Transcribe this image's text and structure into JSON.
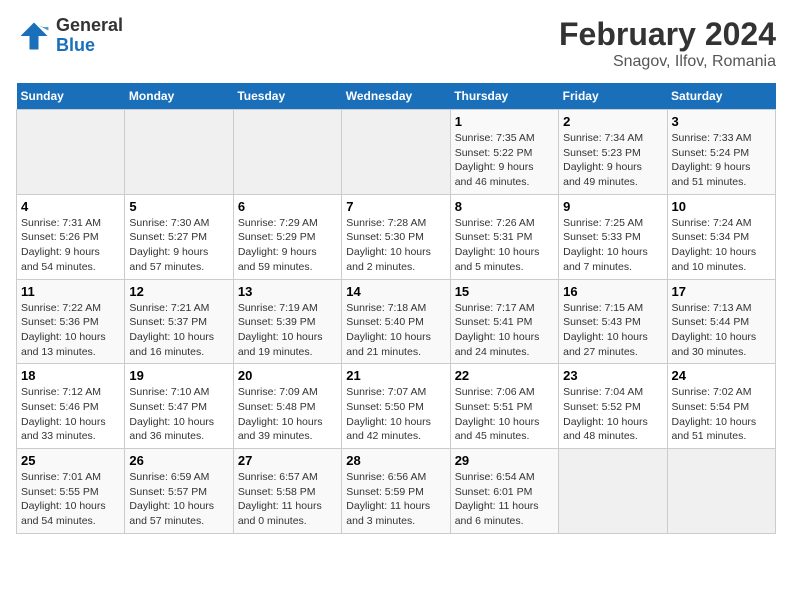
{
  "header": {
    "logo_general": "General",
    "logo_blue": "Blue",
    "title": "February 2024",
    "subtitle": "Snagov, Ilfov, Romania"
  },
  "calendar": {
    "days_of_week": [
      "Sunday",
      "Monday",
      "Tuesday",
      "Wednesday",
      "Thursday",
      "Friday",
      "Saturday"
    ],
    "weeks": [
      [
        {
          "day": "",
          "info": ""
        },
        {
          "day": "",
          "info": ""
        },
        {
          "day": "",
          "info": ""
        },
        {
          "day": "",
          "info": ""
        },
        {
          "day": "1",
          "info": "Sunrise: 7:35 AM\nSunset: 5:22 PM\nDaylight: 9 hours\nand 46 minutes."
        },
        {
          "day": "2",
          "info": "Sunrise: 7:34 AM\nSunset: 5:23 PM\nDaylight: 9 hours\nand 49 minutes."
        },
        {
          "day": "3",
          "info": "Sunrise: 7:33 AM\nSunset: 5:24 PM\nDaylight: 9 hours\nand 51 minutes."
        }
      ],
      [
        {
          "day": "4",
          "info": "Sunrise: 7:31 AM\nSunset: 5:26 PM\nDaylight: 9 hours\nand 54 minutes."
        },
        {
          "day": "5",
          "info": "Sunrise: 7:30 AM\nSunset: 5:27 PM\nDaylight: 9 hours\nand 57 minutes."
        },
        {
          "day": "6",
          "info": "Sunrise: 7:29 AM\nSunset: 5:29 PM\nDaylight: 9 hours\nand 59 minutes."
        },
        {
          "day": "7",
          "info": "Sunrise: 7:28 AM\nSunset: 5:30 PM\nDaylight: 10 hours\nand 2 minutes."
        },
        {
          "day": "8",
          "info": "Sunrise: 7:26 AM\nSunset: 5:31 PM\nDaylight: 10 hours\nand 5 minutes."
        },
        {
          "day": "9",
          "info": "Sunrise: 7:25 AM\nSunset: 5:33 PM\nDaylight: 10 hours\nand 7 minutes."
        },
        {
          "day": "10",
          "info": "Sunrise: 7:24 AM\nSunset: 5:34 PM\nDaylight: 10 hours\nand 10 minutes."
        }
      ],
      [
        {
          "day": "11",
          "info": "Sunrise: 7:22 AM\nSunset: 5:36 PM\nDaylight: 10 hours\nand 13 minutes."
        },
        {
          "day": "12",
          "info": "Sunrise: 7:21 AM\nSunset: 5:37 PM\nDaylight: 10 hours\nand 16 minutes."
        },
        {
          "day": "13",
          "info": "Sunrise: 7:19 AM\nSunset: 5:39 PM\nDaylight: 10 hours\nand 19 minutes."
        },
        {
          "day": "14",
          "info": "Sunrise: 7:18 AM\nSunset: 5:40 PM\nDaylight: 10 hours\nand 21 minutes."
        },
        {
          "day": "15",
          "info": "Sunrise: 7:17 AM\nSunset: 5:41 PM\nDaylight: 10 hours\nand 24 minutes."
        },
        {
          "day": "16",
          "info": "Sunrise: 7:15 AM\nSunset: 5:43 PM\nDaylight: 10 hours\nand 27 minutes."
        },
        {
          "day": "17",
          "info": "Sunrise: 7:13 AM\nSunset: 5:44 PM\nDaylight: 10 hours\nand 30 minutes."
        }
      ],
      [
        {
          "day": "18",
          "info": "Sunrise: 7:12 AM\nSunset: 5:46 PM\nDaylight: 10 hours\nand 33 minutes."
        },
        {
          "day": "19",
          "info": "Sunrise: 7:10 AM\nSunset: 5:47 PM\nDaylight: 10 hours\nand 36 minutes."
        },
        {
          "day": "20",
          "info": "Sunrise: 7:09 AM\nSunset: 5:48 PM\nDaylight: 10 hours\nand 39 minutes."
        },
        {
          "day": "21",
          "info": "Sunrise: 7:07 AM\nSunset: 5:50 PM\nDaylight: 10 hours\nand 42 minutes."
        },
        {
          "day": "22",
          "info": "Sunrise: 7:06 AM\nSunset: 5:51 PM\nDaylight: 10 hours\nand 45 minutes."
        },
        {
          "day": "23",
          "info": "Sunrise: 7:04 AM\nSunset: 5:52 PM\nDaylight: 10 hours\nand 48 minutes."
        },
        {
          "day": "24",
          "info": "Sunrise: 7:02 AM\nSunset: 5:54 PM\nDaylight: 10 hours\nand 51 minutes."
        }
      ],
      [
        {
          "day": "25",
          "info": "Sunrise: 7:01 AM\nSunset: 5:55 PM\nDaylight: 10 hours\nand 54 minutes."
        },
        {
          "day": "26",
          "info": "Sunrise: 6:59 AM\nSunset: 5:57 PM\nDaylight: 10 hours\nand 57 minutes."
        },
        {
          "day": "27",
          "info": "Sunrise: 6:57 AM\nSunset: 5:58 PM\nDaylight: 11 hours\nand 0 minutes."
        },
        {
          "day": "28",
          "info": "Sunrise: 6:56 AM\nSunset: 5:59 PM\nDaylight: 11 hours\nand 3 minutes."
        },
        {
          "day": "29",
          "info": "Sunrise: 6:54 AM\nSunset: 6:01 PM\nDaylight: 11 hours\nand 6 minutes."
        },
        {
          "day": "",
          "info": ""
        },
        {
          "day": "",
          "info": ""
        }
      ]
    ]
  }
}
